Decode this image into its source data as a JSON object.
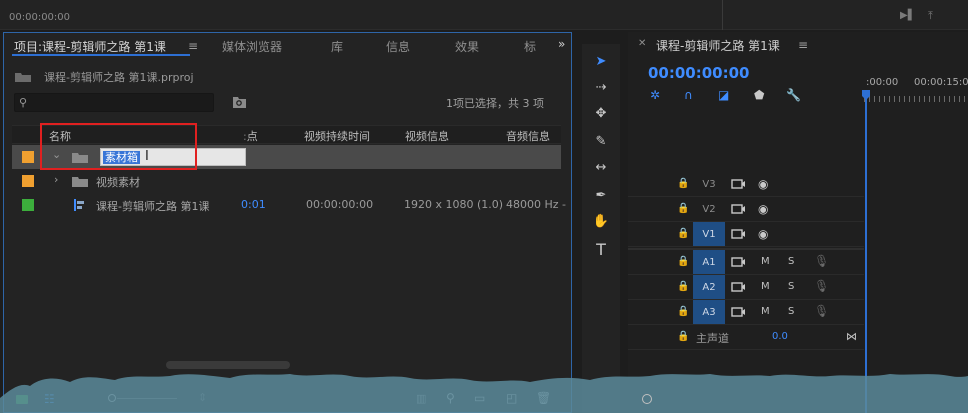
{
  "top": {
    "timecode": "00:00:00:00"
  },
  "project_panel": {
    "tabs": [
      {
        "label": "项目:课程-剪辑师之路 第1课",
        "active": true
      },
      {
        "label": "媒体浏览器"
      },
      {
        "label": "库"
      },
      {
        "label": "信息"
      },
      {
        "label": "效果"
      },
      {
        "label": "标"
      }
    ],
    "more": "»",
    "project_file": "课程-剪辑师之路 第1课.prproj",
    "search": {
      "value": "",
      "placeholder": ""
    },
    "selection_info": "1项已选择，共 3 项",
    "columns": [
      "名称",
      "点",
      "视频持续时间",
      "视频信息",
      "音频信息"
    ],
    "rows": [
      {
        "color": "#f0a030",
        "expand": "⌄",
        "name": "素材箱",
        "editing": true
      },
      {
        "color": "#f0a030",
        "expand": "›",
        "name": "视频素材"
      },
      {
        "color": "#3cae3c",
        "name": "课程-剪辑师之路 第1课",
        "in_point": "0:01",
        "duration": "00:00:00:00",
        "video_info": "1920 x 1080 (1.0)",
        "audio_info": "48000 Hz -"
      }
    ]
  },
  "timeline": {
    "title": "课程-剪辑师之路 第1课",
    "timecode": "00:00:00:00",
    "ruler": [
      ":00:00",
      "00:00:15:00"
    ],
    "video_tracks": [
      {
        "name": "V3",
        "targeted": false
      },
      {
        "name": "V2",
        "targeted": false
      },
      {
        "name": "V1",
        "targeted": true
      }
    ],
    "audio_tracks": [
      {
        "name": "A1",
        "m": "M",
        "s": "S"
      },
      {
        "name": "A2",
        "m": "M",
        "s": "S"
      },
      {
        "name": "A3",
        "m": "M",
        "s": "S"
      }
    ],
    "master": {
      "label": "主声道",
      "value": "0.0"
    }
  },
  "colors": {
    "accent": "#3f8cff",
    "highlight": "#e02020",
    "waveform": "#5a8a9a"
  }
}
